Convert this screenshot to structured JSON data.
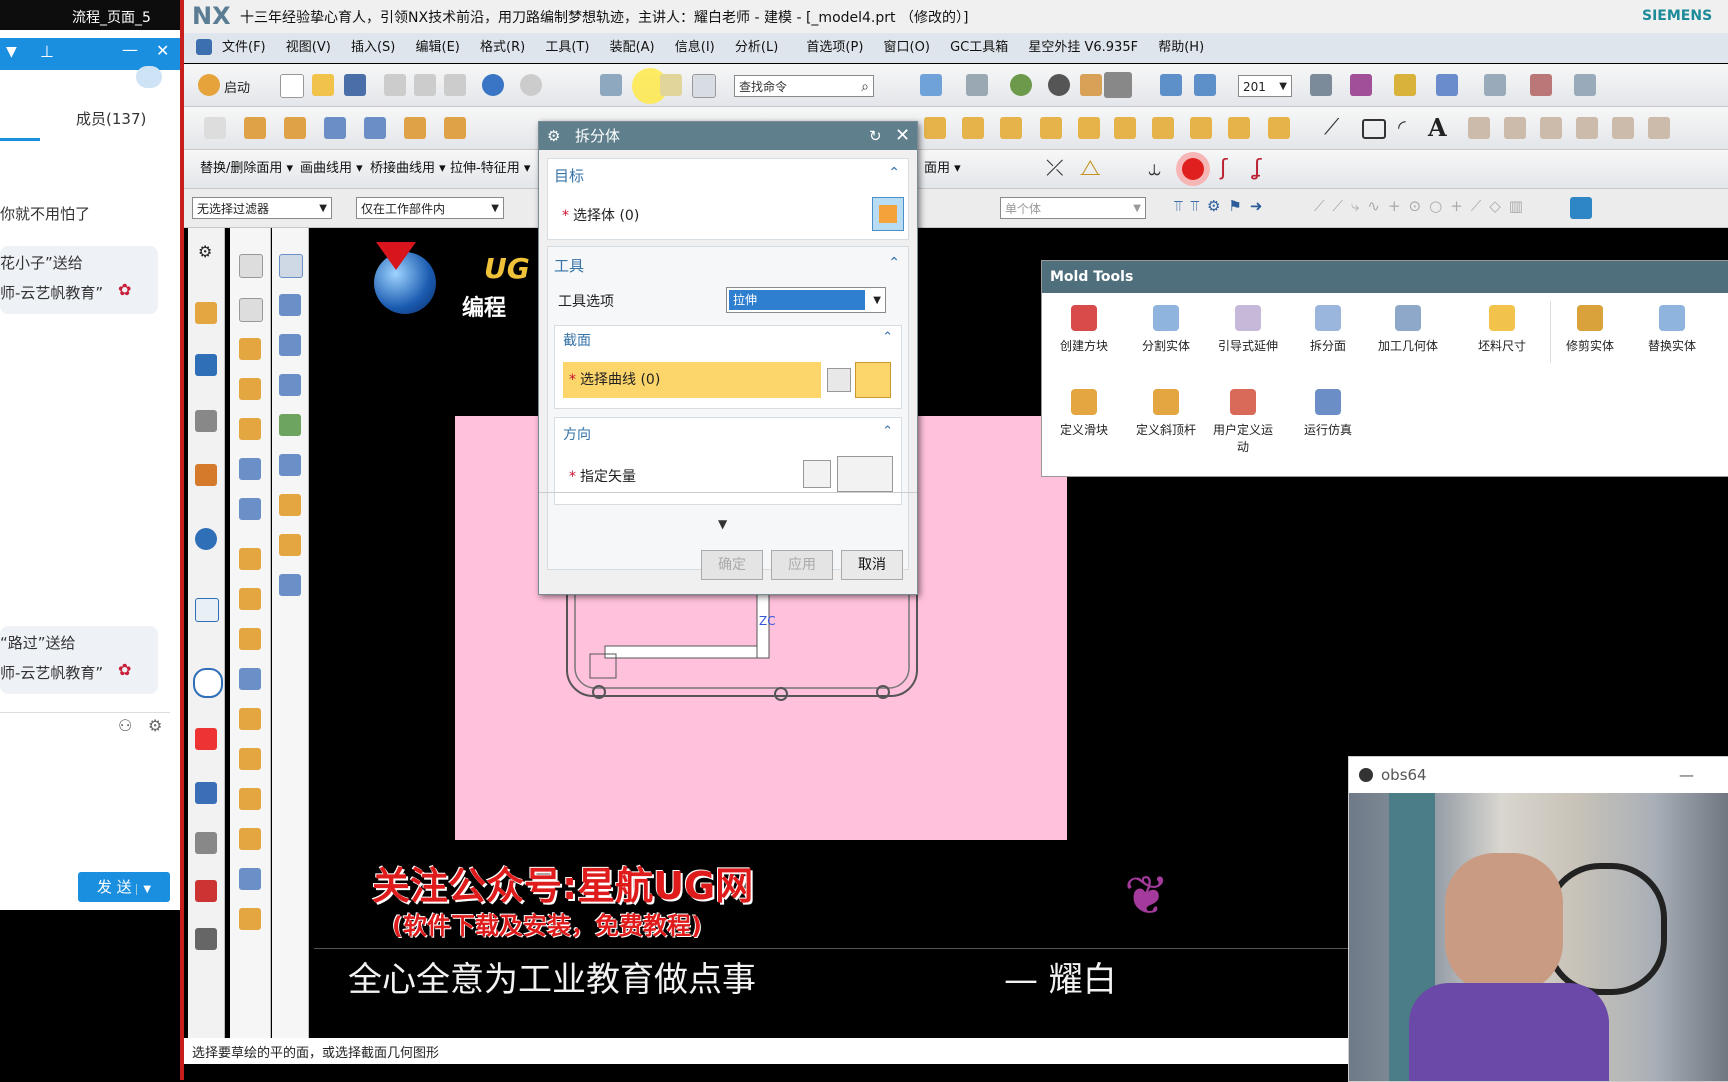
{
  "chat": {
    "top_line": "流程_页面_5",
    "members": "成员(137)",
    "msg1": "你就不用怕了",
    "gift1_a": "花小子”送给",
    "gift1_b": "师-云艺帆教育”",
    "gift2_a": "“路过”送给",
    "gift2_b": "师-云艺帆教育”",
    "send": "发 送"
  },
  "window": {
    "app_logo": "NX",
    "title": "十三年经验挚心育人，引领NX技术前沿，用刀路编制梦想轨迹，主讲人：耀白老师 - 建模 - [_model4.prt （修改的）]",
    "brand": "SIEMENS"
  },
  "menu": [
    "文件(F)",
    "视图(V)",
    "插入(S)",
    "编辑(E)",
    "格式(R)",
    "工具(T)",
    "装配(A)",
    "信息(I)",
    "分析(L)",
    "首选项(P)",
    "窗口(O)",
    "GC工具箱",
    "星空外挂 V6.935F",
    "帮助(H)"
  ],
  "toolbar": {
    "start": "启动",
    "search_placeholder": "查找命令",
    "zoom_value": "201"
  },
  "subcmds": [
    "替换/删除面用",
    "画曲线用",
    "桥接曲线用",
    "拉伸-特征用"
  ],
  "subcmd_right": "面用",
  "filters": {
    "filter": "无选择过滤器",
    "scope": "仅在工作部件内",
    "single": "单个体"
  },
  "dialog": {
    "title": "拆分体",
    "target_header": "目标",
    "select_body": "选择体 (0)",
    "tool_header": "工具",
    "tool_option_label": "工具选项",
    "tool_option_value": "拉伸",
    "section_header": "截面",
    "select_curve": "选择曲线 (0)",
    "direction_header": "方向",
    "specify_vector": "指定矢量",
    "ok": "确定",
    "apply": "应用",
    "cancel": "取消"
  },
  "mold_tools": {
    "title": "Mold Tools",
    "row1": [
      "创建方块",
      "分割实体",
      "引导式延伸",
      "拆分面",
      "加工几何体",
      "坯料尺寸",
      "修剪实体",
      "替换实体"
    ],
    "row2": [
      "定义滑块",
      "定义斜顶杆",
      "用户定义运动",
      "运行仿真"
    ]
  },
  "overlay": {
    "logo_top": "UG",
    "logo_bottom": "编程",
    "promo1": "关注公众号:星航UG网",
    "promo2": "(软件下载及安装，免费教程)",
    "slogan": "全心全意为工业教育做点事",
    "author": "— 耀白",
    "zc": "ZC"
  },
  "webcam": {
    "title": "obs64",
    "min": "—"
  },
  "status": "选择要草绘的平的面，或选择截面几何图形"
}
